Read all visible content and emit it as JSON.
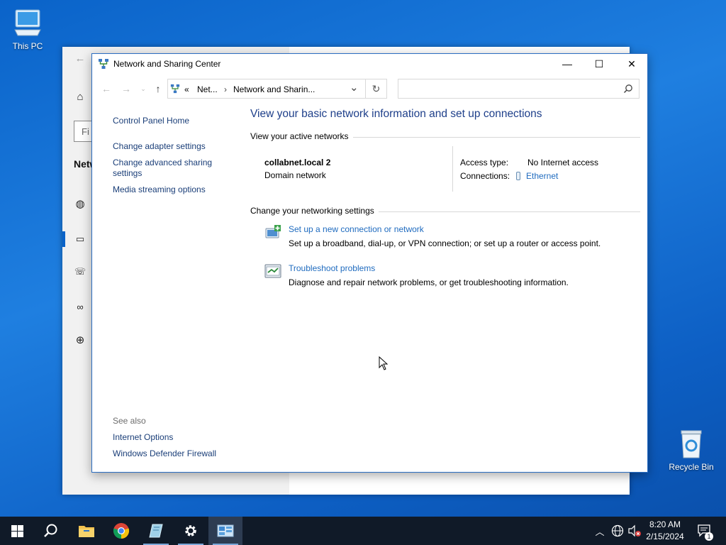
{
  "desktop": {
    "this_pc_label": "This PC",
    "recycle_bin_label": "Recycle Bin"
  },
  "background_window": {
    "find_placeholder": "Fi",
    "title_fragment": "Netw"
  },
  "window": {
    "title": "Network and Sharing Center",
    "minimize": "—",
    "maximize": "☐",
    "close": "✕"
  },
  "address": {
    "overflow": "«",
    "crumb1": "Net...",
    "separator": "›",
    "crumb2": "Network and Sharin...",
    "dropdown": "⌄",
    "refresh": "↻",
    "search_placeholder": ""
  },
  "nav": {
    "home": "Control Panel Home",
    "adapter": "Change adapter settings",
    "advanced_line1": "Change advanced sharing",
    "advanced_line2": "settings",
    "media": "Media streaming options",
    "see_also": "See also",
    "internet_options": "Internet Options",
    "firewall": "Windows Defender Firewall"
  },
  "content": {
    "heading": "View your basic network information and set up connections",
    "active_title": "View your active networks",
    "network_name": "collabnet.local 2",
    "network_type": "Domain network",
    "access_type_label": "Access type:",
    "access_type_value": "No Internet access",
    "connections_label": "Connections:",
    "connections_value": "Ethernet",
    "change_title": "Change your networking settings",
    "task1_link": "Set up a new connection or network",
    "task1_desc": "Set up a broadband, dial-up, or VPN connection; or set up a router or access point.",
    "task2_link": "Troubleshoot problems",
    "task2_desc": "Diagnose and repair network problems, or get troubleshooting information."
  },
  "taskbar": {
    "time": "8:20 AM",
    "date": "2/15/2024",
    "notification_count": "1"
  },
  "colors": {
    "link": "#1f6bbf",
    "heading": "#1e3f8a",
    "taskbar": "#101a28",
    "desktop": "#0a63c9"
  }
}
